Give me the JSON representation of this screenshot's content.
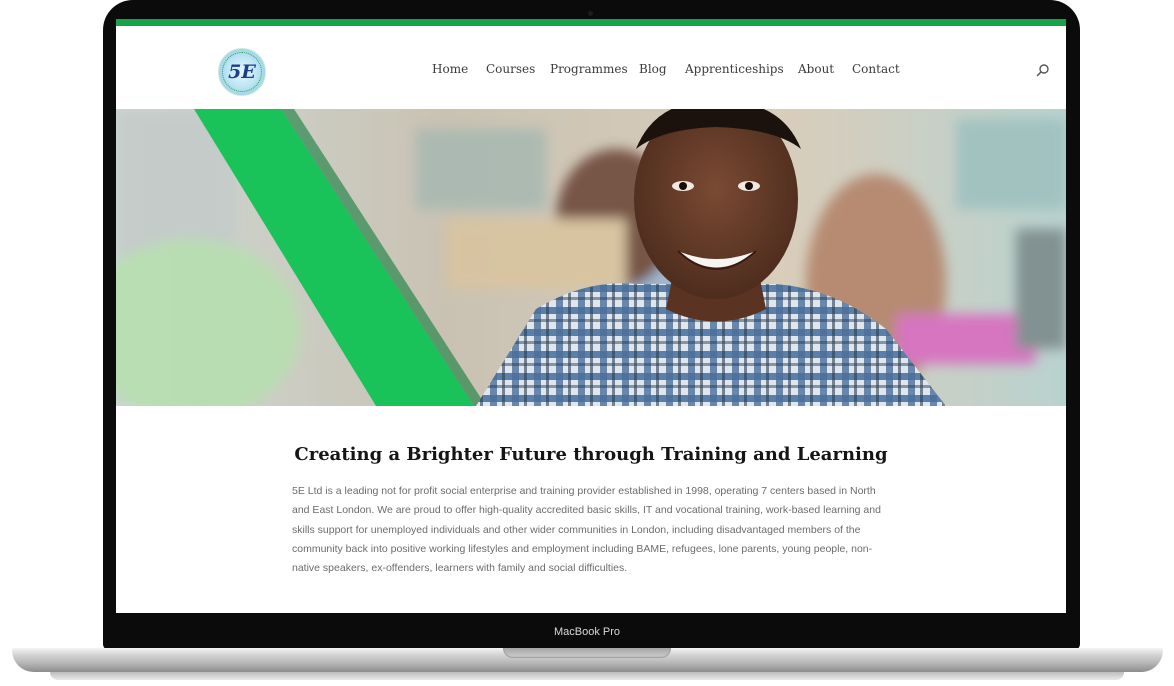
{
  "device": {
    "label": "MacBook Pro"
  },
  "header": {
    "logo_text": "5E",
    "nav": [
      "Home",
      "Courses",
      "Programmes",
      "Blog",
      "Apprenticeships",
      "About",
      "Contact"
    ],
    "search_icon": "search-icon"
  },
  "hero": {
    "accent_color": "#19c35a"
  },
  "content": {
    "heading": "Creating a Brighter Future through Training and Learning",
    "paragraph": "5E Ltd is a leading not for profit social enterprise and training provider established in 1998, operating 7 centers based in North and East London. We are proud to offer high-quality accredited basic skills, IT and vocational training, work-based learning and skills support for unemployed individuals and other wider communities in London, including disadvantaged members of the community back into positive working lifestyles and employment including BAME, refugees, lone parents, young people, non-native speakers, ex-offenders, learners with family and social difficulties."
  },
  "colors": {
    "brand_green": "#17a34a",
    "text_dark": "#151515",
    "text_muted": "#6c6c6c"
  }
}
